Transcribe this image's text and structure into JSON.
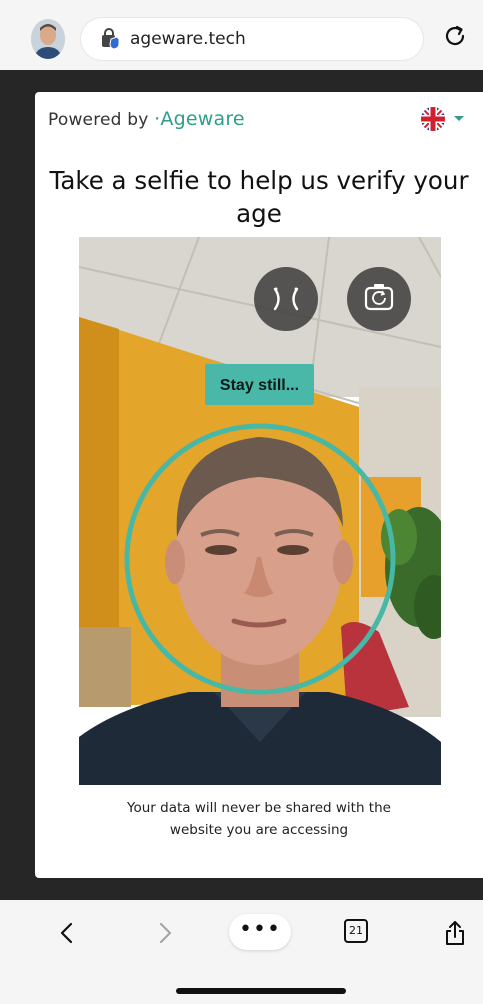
{
  "browser": {
    "url": "ageware.tech",
    "tab_count": "21",
    "more_label": "•••"
  },
  "card": {
    "powered_by": "Powered by",
    "brand": "Ageware",
    "headline": "Take a selfie to help us verify your age",
    "status": "Stay still...",
    "footer_line1": "Your data will never be shared with the",
    "footer_line2": "website you are accessing"
  },
  "icons": {
    "avatar": "user-avatar-icon",
    "lock": "site-security-icon",
    "reload": "reload-icon",
    "flag": "uk-flag-icon",
    "mirror": "mirror-flip-icon",
    "switch_camera": "switch-camera-icon",
    "back": "back-chevron-icon",
    "forward": "forward-chevron-icon",
    "share": "share-icon"
  },
  "colors": {
    "accent": "#2e9e8a",
    "status_bg": "#49b8a8",
    "frame": "#262626",
    "bar": "#f5f5f6"
  }
}
